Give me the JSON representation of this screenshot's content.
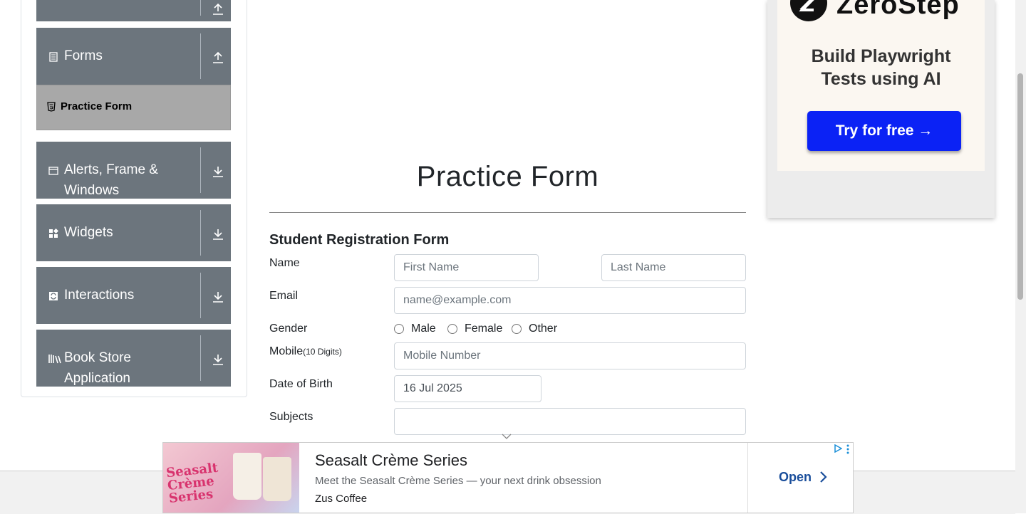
{
  "sidebar": {
    "groups": [
      {
        "title": "",
        "expanded": true
      },
      {
        "title": "Forms",
        "expanded": true
      },
      {
        "title": "Alerts, Frame & Windows",
        "expanded": false
      },
      {
        "title": "Widgets",
        "expanded": false
      },
      {
        "title": "Interactions",
        "expanded": false
      },
      {
        "title": "Book Store Application",
        "expanded": false
      }
    ],
    "forms_items": [
      {
        "label": "Practice Form",
        "active": true
      }
    ]
  },
  "main": {
    "page_title": "Practice Form",
    "form_title": "Student Registration Form",
    "name_label": "Name",
    "first_name_placeholder": "First Name",
    "last_name_placeholder": "Last Name",
    "email_label": "Email",
    "email_placeholder": "name@example.com",
    "gender_label": "Gender",
    "gender_options": [
      "Male",
      "Female",
      "Other"
    ],
    "mobile_label": "Mobile",
    "mobile_hint": "(10 Digits)",
    "mobile_placeholder": "Mobile Number",
    "dob_label": "Date of Birth",
    "dob_value": "16 Jul 2025",
    "subjects_label": "Subjects",
    "subjects_value": ""
  },
  "ad_right": {
    "brand": "ZeroStep",
    "headline_line1": "Build Playwright",
    "headline_line2": "Tests using AI",
    "cta": "Try for free →",
    "colors": {
      "cta": "#0b22f5"
    }
  },
  "ad_bottom": {
    "title": "Seasalt Crème Series",
    "description": "Meet the Seasalt Crème Series — your next drink obsession",
    "advertiser": "Zus Coffee",
    "open_label": "Open",
    "image_text": "Seasalt Crème Series"
  }
}
